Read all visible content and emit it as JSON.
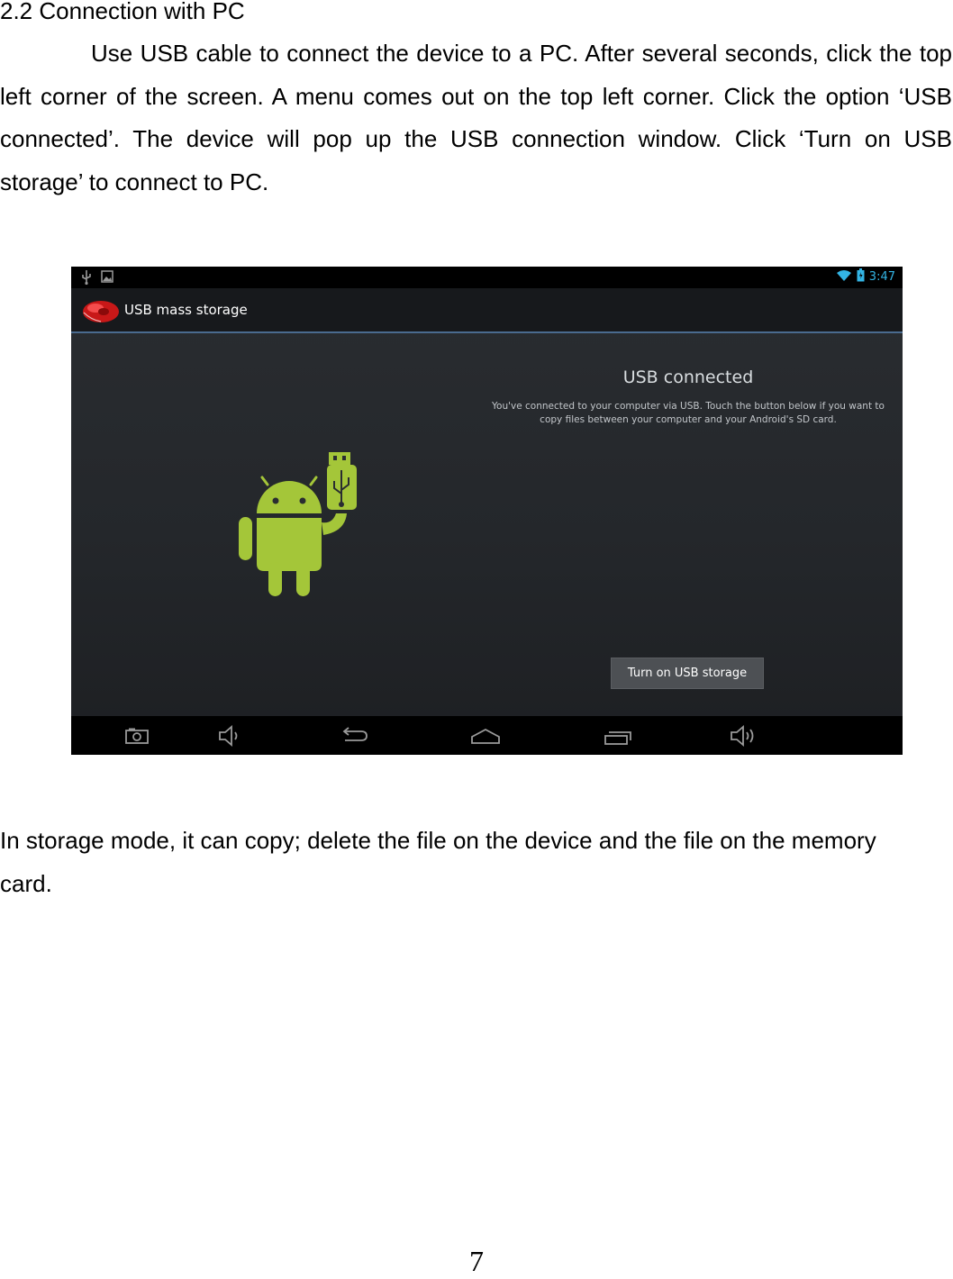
{
  "document": {
    "heading": "2.2 Connection with PC",
    "paragraph1": "Use USB cable to connect the device to a PC. After several seconds, click the top left corner of the screen.  A menu comes out on the top left corner. Click the option ‘USB connected’. The device will pop up the USB connection window. Click ‘Turn on USB storage’ to connect to PC.",
    "paragraph2": "In storage mode, it can copy; delete the file on the device and the file on the memory card.",
    "page_number": "7"
  },
  "screenshot": {
    "status_bar": {
      "left_icons": [
        "usb-icon",
        "picture-icon"
      ],
      "right_icons": [
        "wifi-icon",
        "battery-icon"
      ],
      "time": "3:47",
      "accent_color": "#33b5e5"
    },
    "action_bar": {
      "title": "USB mass storage",
      "icon": "usb-app-icon"
    },
    "usb_panel": {
      "title": "USB connected",
      "description": "You've connected to your computer via USB. Touch the button below if you want to copy files between your computer and your Android's SD card.",
      "button_label": "Turn on USB storage"
    },
    "illustration": "android-robot-holding-usb-icon",
    "nav_bar": {
      "buttons": [
        "screenshot-icon",
        "volume-down-icon",
        "back-icon",
        "home-icon",
        "recent-apps-icon",
        "volume-up-icon"
      ]
    }
  }
}
